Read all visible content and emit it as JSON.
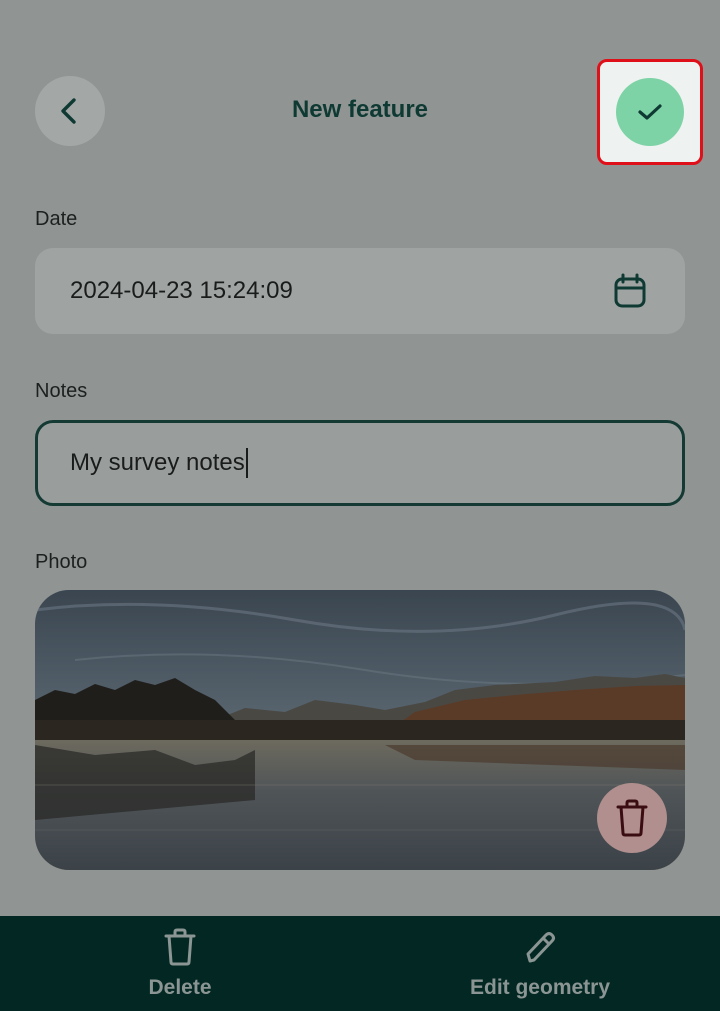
{
  "header": {
    "title": "New feature",
    "back_icon": "chevron-left-icon",
    "confirm_icon": "check-icon"
  },
  "form": {
    "date": {
      "label": "Date",
      "value": "2024-04-23 15:24:09",
      "icon": "calendar-icon"
    },
    "notes": {
      "label": "Notes",
      "value": "My survey notes"
    },
    "photo": {
      "label": "Photo",
      "delete_icon": "trash-icon"
    }
  },
  "bottom_bar": {
    "delete_label": "Delete",
    "edit_label": "Edit geometry"
  },
  "colors": {
    "accent": "#7dd3a6",
    "dark_green": "#032823",
    "highlight": "#e0101a"
  }
}
